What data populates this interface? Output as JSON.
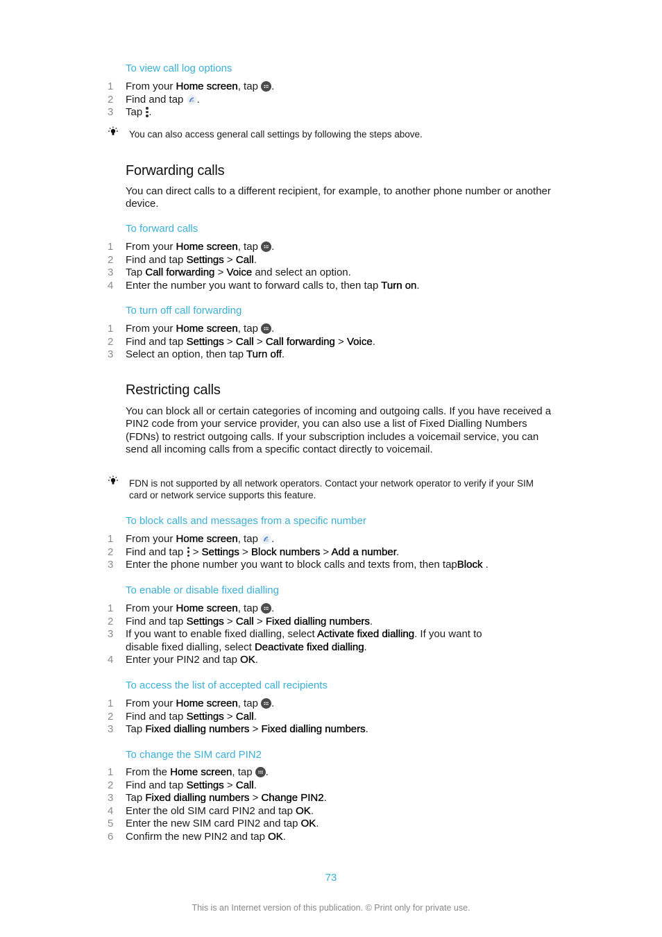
{
  "sections": {
    "view_call_log": {
      "title": "To view call log options",
      "steps": [
        {
          "num": "1",
          "pre": "From your ",
          "b1": "Home screen",
          "mid": ", tap ",
          "icon": "apps-icon",
          "post": "."
        },
        {
          "num": "2",
          "pre": "Find and tap ",
          "icon": "phone-app-icon",
          "post": "."
        },
        {
          "num": "3",
          "pre": "Tap ",
          "icon": "more-options-icon",
          "post": "."
        }
      ],
      "note": "You can also access general call settings by following the steps above."
    },
    "forwarding": {
      "heading": "Forwarding calls",
      "intro": "You can direct calls to a different recipient, for example, to another phone number or another device.",
      "forward": {
        "title": "To forward calls",
        "steps": [
          {
            "num": "1",
            "pre": "From your ",
            "b1": "Home screen",
            "mid": ", tap ",
            "icon": "apps-icon",
            "post": "."
          },
          {
            "num": "2",
            "pre": "Find and tap ",
            "b1": "Settings",
            "sep1": " > ",
            "b2": "Call",
            "post": "."
          },
          {
            "num": "3",
            "pre": "Tap ",
            "b1": "Call forwarding",
            "sep1": " > ",
            "b2": "Voice",
            "post": " and select an option."
          },
          {
            "num": "4",
            "pre": "Enter the number you want to forward calls to, then tap ",
            "b1": "Turn on",
            "post": "."
          }
        ]
      },
      "turn_off": {
        "title": "To turn off call forwarding",
        "steps": [
          {
            "num": "1",
            "pre": "From your ",
            "b1": "Home screen",
            "mid": ", tap ",
            "icon": "apps-icon",
            "post": "."
          },
          {
            "num": "2",
            "pre": "Find and tap ",
            "b1": "Settings",
            "sep1": " > ",
            "b2": "Call",
            "sep2": " > ",
            "b3": "Call forwarding",
            "sep3": " > ",
            "b4": "Voice",
            "post": "."
          },
          {
            "num": "3",
            "pre": "Select an option, then tap ",
            "b1": "Turn off",
            "post": "."
          }
        ]
      }
    },
    "restricting": {
      "heading": "Restricting calls",
      "intro": "You can block all or certain categories of incoming and outgoing calls. If you have received a PIN2 code from your service provider, you can also use a list of Fixed Dialling Numbers (FDNs) to restrict outgoing calls. If your subscription includes a voicemail service, you can send all incoming calls from a specific contact directly to voicemail.",
      "note": "FDN is not supported by all network operators. Contact your network operator to verify if your SIM card or network service supports this feature.",
      "block": {
        "title": "To block calls and messages from a specific number",
        "steps": [
          {
            "num": "1",
            "pre": "From your ",
            "b1": "Home screen",
            "mid": ", tap ",
            "icon": "phone-app-icon",
            "post": "."
          },
          {
            "num": "2",
            "pre": "Find and tap ",
            "icon": "more-options-icon",
            "sep0": " > ",
            "b1": "Settings",
            "sep1": " > ",
            "b2": "Block numbers",
            "sep2": " > ",
            "b3": "Add a number",
            "post": "."
          },
          {
            "num": "3",
            "pre": "Enter the phone number you want to block calls and texts from, then tap",
            "b1": "Block",
            "post": " ."
          }
        ]
      },
      "fixed_dialling": {
        "title": "To enable or disable fixed dialling",
        "steps": [
          {
            "num": "1",
            "pre": "From your ",
            "b1": "Home screen",
            "mid": ", tap ",
            "icon": "apps-icon",
            "post": "."
          },
          {
            "num": "2",
            "pre": "Find and tap ",
            "b1": "Settings",
            "sep1": " > ",
            "b2": "Call",
            "sep2": " > ",
            "b3": "Fixed dialling numbers",
            "post": "."
          },
          {
            "num": "3",
            "pre": "If you want to enable fixed dialling, select ",
            "b1": "Activate fixed dialling",
            "mid": ". If you want to disable fixed dialling, select ",
            "b2": "Deactivate fixed dialling",
            "post": "."
          },
          {
            "num": "4",
            "pre": "Enter your PIN2 and tap ",
            "b1": "OK",
            "post": "."
          }
        ]
      },
      "accepted": {
        "title": "To access the list of accepted call recipients",
        "steps": [
          {
            "num": "1",
            "pre": "From your ",
            "b1": "Home screen",
            "mid": ", tap ",
            "icon": "apps-icon",
            "post": "."
          },
          {
            "num": "2",
            "pre": "Find and tap ",
            "b1": "Settings",
            "sep1": " > ",
            "b2": "Call",
            "post": "."
          },
          {
            "num": "3",
            "pre": "Tap ",
            "b1": "Fixed dialling numbers",
            "sep1": " > ",
            "b2": "Fixed dialling numbers",
            "post": "."
          }
        ]
      },
      "pin2": {
        "title": "To change the SIM card PIN2",
        "steps": [
          {
            "num": "1",
            "pre": "From the ",
            "b1": "Home screen",
            "mid": ", tap ",
            "icon": "apps-icon",
            "post": "."
          },
          {
            "num": "2",
            "pre": "Find and tap ",
            "b1": "Settings",
            "sep1": " > ",
            "b2": "Call",
            "post": "."
          },
          {
            "num": "3",
            "pre": "Tap ",
            "b1": "Fixed dialling numbers",
            "sep1": " > ",
            "b2": "Change PIN2",
            "post": "."
          },
          {
            "num": "4",
            "pre": "Enter the old SIM card PIN2 and tap ",
            "b1": "OK",
            "post": "."
          },
          {
            "num": "5",
            "pre": "Enter the new SIM card PIN2 and tap ",
            "b1": "OK",
            "post": "."
          },
          {
            "num": "6",
            "pre": "Confirm the new PIN2 and tap ",
            "b1": "OK",
            "post": "."
          }
        ]
      }
    }
  },
  "page_number": "73",
  "footer": "This is an Internet version of this publication. © Print only for private use.",
  "colors": {
    "accent": "#3bb0d8",
    "text": "#1a1a1a",
    "step_number": "#8a8a8a",
    "footer": "#8a8a8a"
  }
}
